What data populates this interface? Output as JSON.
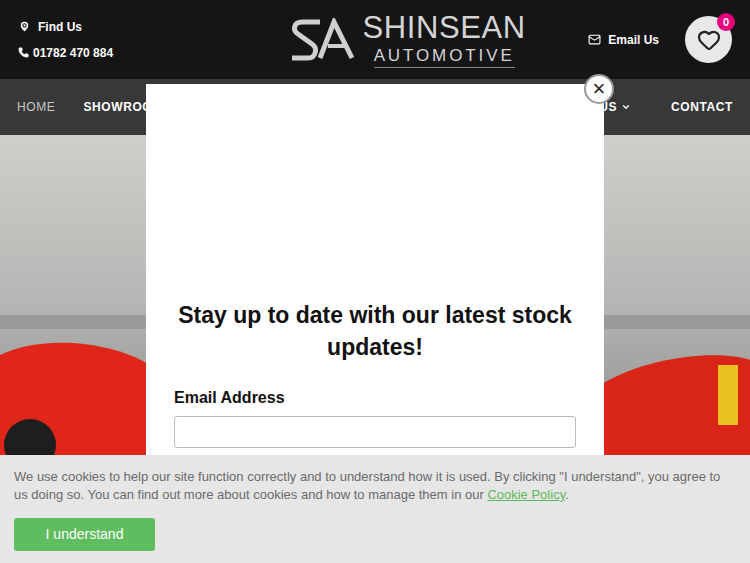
{
  "header": {
    "find_us": "Find Us",
    "phone": "01782 470 884",
    "logo": {
      "title": "SHINSEAN",
      "subtitle": "AUTOMOTIVE"
    },
    "email": "Email Us",
    "basket_count": "0"
  },
  "nav": [
    {
      "label": "HOME",
      "selected": true,
      "dropdown": false
    },
    {
      "label": "SHOWROO",
      "selected": false,
      "dropdown": false
    },
    {
      "label": "UT US",
      "selected": false,
      "dropdown": true
    },
    {
      "label": "CONTACT",
      "selected": false,
      "dropdown": false
    }
  ],
  "modal": {
    "close": "×",
    "heading": "Stay up to date with our latest stock updates!",
    "email_label": "Email Address",
    "email_value": ""
  },
  "cookie_bar": {
    "text": "We use cookies to help our site function correctly and to understand how it is used. By clicking \"I understand\", you agree to us doing so. You can find out more about cookies and how to manage them in our ",
    "link": "Cookie Policy",
    "after": ".",
    "button": "I understand"
  }
}
